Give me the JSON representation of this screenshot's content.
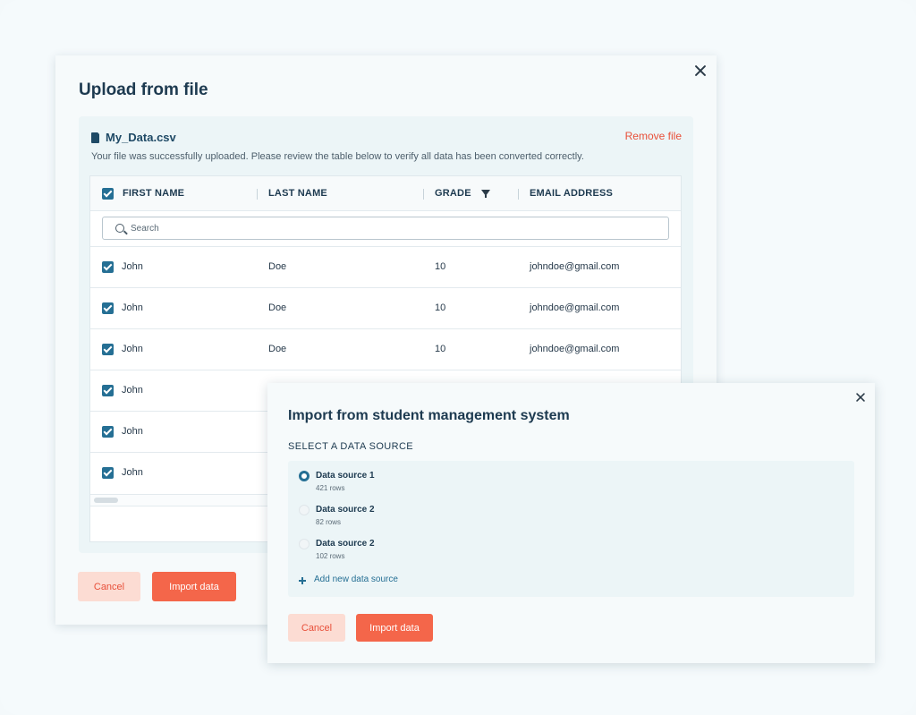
{
  "upload_dialog": {
    "title": "Upload from file",
    "file_name": "My_Data.csv",
    "remove_label": "Remove file",
    "message": "Your file was successfully uploaded. Please review the table below to verify all data has been converted correctly.",
    "columns": [
      "FIRST NAME",
      "LAST NAME",
      "GRADE",
      "EMAIL ADDRESS"
    ],
    "search_placeholder": "Search",
    "rows": [
      {
        "first": "John",
        "last": "Doe",
        "grade": "10",
        "email": "johndoe@gmail.com"
      },
      {
        "first": "John",
        "last": "Doe",
        "grade": "10",
        "email": "johndoe@gmail.com"
      },
      {
        "first": "John",
        "last": "Doe",
        "grade": "10",
        "email": "johndoe@gmail.com"
      },
      {
        "first": "John",
        "last": "",
        "grade": "",
        "email": ""
      },
      {
        "first": "John",
        "last": "",
        "grade": "",
        "email": ""
      },
      {
        "first": "John",
        "last": "",
        "grade": "",
        "email": ""
      }
    ],
    "cancel_label": "Cancel",
    "import_label": "Import data"
  },
  "import_dialog": {
    "title": "Import from student management system",
    "section_label": "SELECT A DATA SOURCE",
    "sources": [
      {
        "name": "Data source 1",
        "rows": "421 rows",
        "selected": true
      },
      {
        "name": "Data source 2",
        "rows": "82 rows",
        "selected": false
      },
      {
        "name": "Data source 2",
        "rows": "102 rows",
        "selected": false
      }
    ],
    "add_label": "Add new data source",
    "cancel_label": "Cancel",
    "import_label": "Import data"
  },
  "colors": {
    "accent": "#256f94",
    "primary_button": "#f4664a",
    "cancel_button_bg": "#fcdcd3",
    "danger_text": "#e8503a"
  },
  "icons": [
    "close-icon",
    "file-icon",
    "checkbox-checked-icon",
    "filter-icon",
    "search-icon",
    "radio-icon",
    "plus-icon"
  ]
}
